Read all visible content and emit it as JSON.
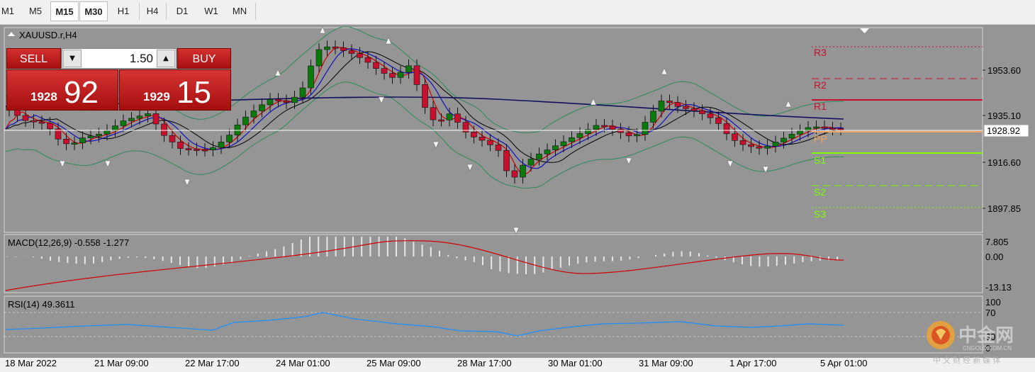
{
  "timeframes": [
    {
      "label": "M1",
      "active": false
    },
    {
      "label": "M5",
      "active": false
    },
    {
      "label": "M15",
      "active": true
    },
    {
      "label": "M30",
      "active": true
    },
    {
      "label": "H1",
      "active": false
    },
    {
      "label": "H4",
      "active": false
    },
    {
      "label": "D1",
      "active": false
    },
    {
      "label": "W1",
      "active": false
    },
    {
      "label": "MN",
      "active": false
    }
  ],
  "chart": {
    "title": "XAUUSD.r,H4",
    "price_labels": [
      "1953.60",
      "1935.10",
      "1916.60",
      "1897.85"
    ],
    "current_price": "1928.92",
    "pivots": {
      "R3": "R3",
      "R2": "R2",
      "R1": "R1",
      "PP": "PP",
      "S1": "S1",
      "S2": "S2",
      "S3": "S3"
    },
    "time_labels": [
      "18 Mar 2022",
      "21 Mar 09:00",
      "22 Mar 17:00",
      "24 Mar 01:00",
      "25 Mar 09:00",
      "28 Mar 17:00",
      "30 Mar 01:00",
      "31 Mar 09:00",
      "1 Apr 17:00",
      "5 Apr 01:00"
    ],
    "macd_label": "MACD(12,26,9) -0.558 -1.277",
    "macd_levels": [
      "7.805",
      "0.00",
      "-13.13"
    ],
    "rsi_label": "RSI(14) 49.3611",
    "rsi_levels": [
      "100",
      "70",
      "30",
      "0"
    ]
  },
  "trade": {
    "sell_label": "SELL",
    "buy_label": "BUY",
    "lot": "1.50",
    "sell_small": "1928",
    "sell_big": "92",
    "buy_small": "1929",
    "buy_big": "15"
  },
  "watermark": {
    "cn": "中金网",
    "domain": "CNGOLD.COM.CN",
    "sub": "中 文 财 经 新 媒 体"
  },
  "colors": {
    "bull": "#0a7a0a",
    "bear": "#c8102e",
    "bb": "#2e8b57",
    "ma_fast": "#d00000",
    "ma_mid": "#1010c0",
    "ma_slow": "#000000",
    "resistance": "#c8102e",
    "support": "#7cfc00",
    "pp": "#f4a460"
  }
}
